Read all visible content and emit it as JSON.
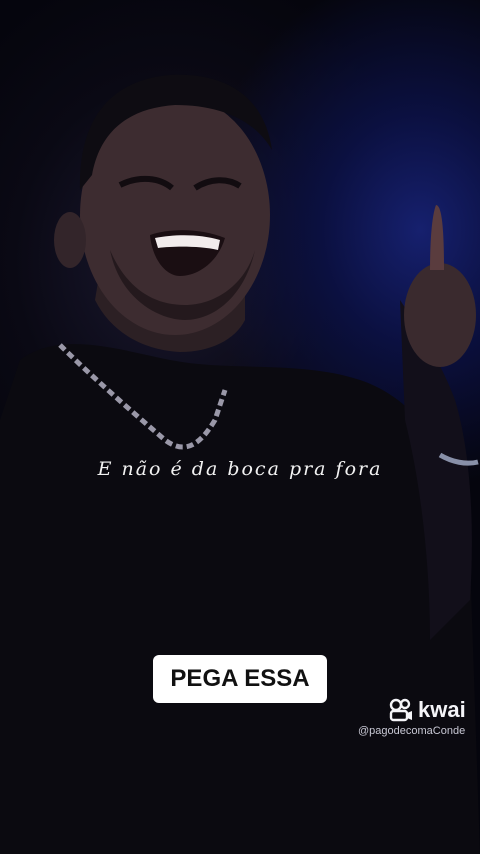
{
  "video": {
    "caption": "E não é da boca pra fora",
    "cta_label": "PEGA ESSA"
  },
  "watermark": {
    "brand": "kwai",
    "brand_icon": "kwai-logo-icon",
    "handle": "@pagodecomaConde"
  },
  "colors": {
    "background": "#05050d",
    "stage_light": "#16206e",
    "cta_background": "#ffffff",
    "cta_text": "#111111"
  }
}
